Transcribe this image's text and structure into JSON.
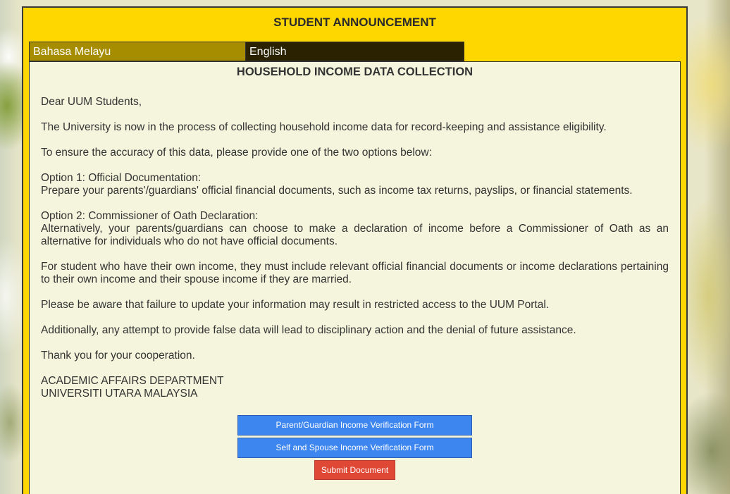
{
  "banner": {
    "title": "STUDENT ANNOUNCEMENT"
  },
  "tabs": [
    {
      "label": "Bahasa Melayu"
    },
    {
      "label": "English"
    }
  ],
  "panel": {
    "title": "HOUSEHOLD INCOME DATA COLLECTION",
    "greeting": "Dear UUM Students,",
    "intro": "The University is now in the process of collecting household income data for record-keeping and assistance eligibility.",
    "instruction": "To ensure the accuracy of this data, please provide one of the two options below:",
    "option1_title": "Option 1: Official Documentation:",
    "option1_text": "Prepare your parents'/guardians' official financial documents, such as income tax returns, payslips, or financial statements.",
    "option2_title": "Option 2: Commissioner of Oath Declaration:",
    "option2_text": "Alternatively, your parents/guardians can choose to make a declaration of income before a Commissioner of Oath as an alternative for individuals who do not have official documents.",
    "own_income": "For student who have their own income, they must include relevant official financial documents or income declarations pertaining to their own income and their spouse income if they are married.",
    "warning": "Please be aware that failure to update your information may result in restricted access to the UUM Portal.",
    "false_data": "Additionally, any attempt to provide false data will lead to disciplinary action and the denial of future assistance.",
    "thanks": "Thank you for your cooperation.",
    "signature_dept": "ACADEMIC AFFAIRS DEPARTMENT",
    "signature_univ": "UNIVERSITI UTARA MALAYSIA"
  },
  "buttons": {
    "parent_form": "Parent/Guardian Income Verification Form",
    "self_form": "Self and Spouse Income Verification Form",
    "submit": "Submit Document"
  },
  "colors": {
    "banner": "#ffd700",
    "tab_bm": "#a68d00",
    "tab_en": "#2a2200",
    "panel_bg": "#f4f5dc",
    "button_blue": "#3d86f0",
    "button_red": "#e04836"
  }
}
